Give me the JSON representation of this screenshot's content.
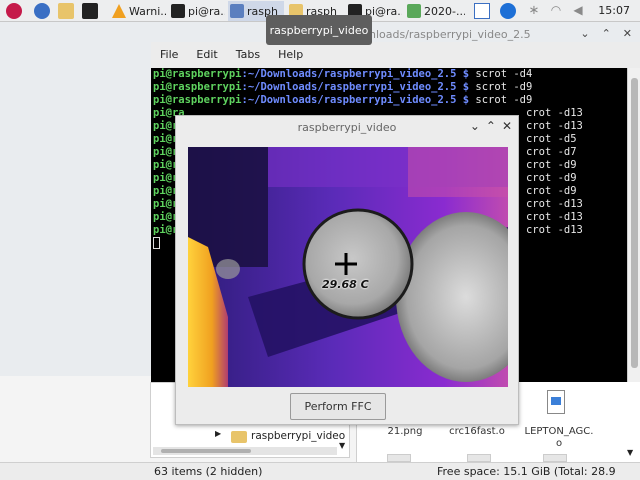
{
  "taskbar": {
    "tasks": [
      {
        "label": "Warni..."
      },
      {
        "label": "pi@ra..."
      },
      {
        "label": "rasph"
      },
      {
        "label": "rasph"
      },
      {
        "label": "pi@ra..."
      },
      {
        "label": "2020-..."
      }
    ],
    "clock": "15:07"
  },
  "tooltip": "raspberrypi_video",
  "terminal": {
    "title": "pi@raspberrypi: ~/Downloads/raspberrypi_video_2.5",
    "visible_title_fragment": "nloads/raspberrypi_video_2.5",
    "menu": [
      "File",
      "Edit",
      "Tabs",
      "Help"
    ],
    "prompt_user": "pi@raspberrypi",
    "prompt_path": ":~/Downloads/raspberrypi_video_2.5 $",
    "visible_lines": [
      {
        "user": "pi@raspberrypi",
        "path": ":~/Downloads/raspberrypi_video_2.5 $",
        "cmd": " scrot -d4"
      },
      {
        "user": "pi@raspberrypi",
        "path": ":~/Downloads/raspberrypi_video_2.5 $",
        "cmd": " scrot -d9"
      },
      {
        "user": "pi@raspberrypi",
        "path": ":~/Downloads/raspberrypi_video_2.5 $",
        "cmd": " scrot -d9"
      },
      {
        "user": "pi@ra",
        "path": "",
        "cmd": "crot -d13"
      },
      {
        "user": "pi@ra",
        "path": "",
        "cmd": "crot -d13"
      },
      {
        "user": "pi@ra",
        "path": "",
        "cmd": "crot -d5"
      },
      {
        "user": "pi@ra",
        "path": "",
        "cmd": "crot -d7"
      },
      {
        "user": "pi@ra",
        "path": "",
        "cmd": "crot -d9"
      },
      {
        "user": "pi@ra",
        "path": "",
        "cmd": "crot -d9"
      },
      {
        "user": "pi@ra",
        "path": "",
        "cmd": "crot -d9"
      },
      {
        "user": "pi@ra",
        "path": "",
        "cmd": "crot -d13"
      },
      {
        "user": "pi@ra",
        "path": "",
        "cmd": "crot -d13"
      },
      {
        "user": "pi@ra",
        "path": "",
        "cmd": "crot -d13"
      }
    ]
  },
  "video_window": {
    "title": "raspberrypi_video",
    "temperature": "29.68 C",
    "ffc_button": "Perform FFC"
  },
  "file_manager": {
    "tree_folder": "raspberrypi_video",
    "files": [
      "21.png",
      "crc16fast.o",
      "LEPTON_AGC.\no"
    ],
    "status_left": "63 items (2 hidden)",
    "status_right": "Free space: 15.1 GiB (Total: 28.9 GiB)"
  },
  "colors": {
    "prompt_user": "#5fd35f",
    "prompt_path": "#6f8cff",
    "thermal_dark": "#2a1670",
    "thermal_hot": "#ffd23c"
  }
}
